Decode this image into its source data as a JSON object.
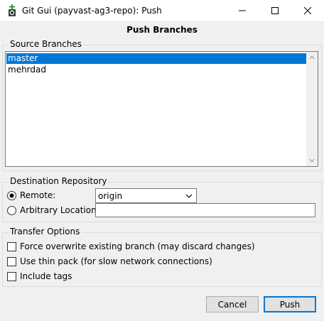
{
  "window": {
    "title": "Git Gui (payvast-ag3-repo): Push",
    "icon": "git-gui-icon",
    "controls": [
      "minimize-icon",
      "maximize-icon",
      "close-icon"
    ]
  },
  "heading": "Push Branches",
  "source_branches": {
    "label": "Source Branches",
    "items": [
      {
        "label": "master",
        "selected": true
      },
      {
        "label": "mehrdad",
        "selected": false
      }
    ]
  },
  "destination": {
    "label": "Destination Repository",
    "remote_label": "Remote:",
    "remote_value": "origin",
    "remote_selected": true,
    "arbitrary_label": "Arbitrary Location:",
    "arbitrary_value": ""
  },
  "transfer_options": {
    "label": "Transfer Options",
    "options": [
      {
        "label": "Force overwrite existing branch (may discard changes)",
        "checked": false
      },
      {
        "label": "Use thin pack (for slow network connections)",
        "checked": false
      },
      {
        "label": "Include tags",
        "checked": false
      }
    ]
  },
  "buttons": {
    "cancel": "Cancel",
    "push": "Push"
  },
  "colors": {
    "selection": "#0078d7",
    "default_button_border": "#0078d7",
    "window_bg": "#f0f0f0"
  }
}
